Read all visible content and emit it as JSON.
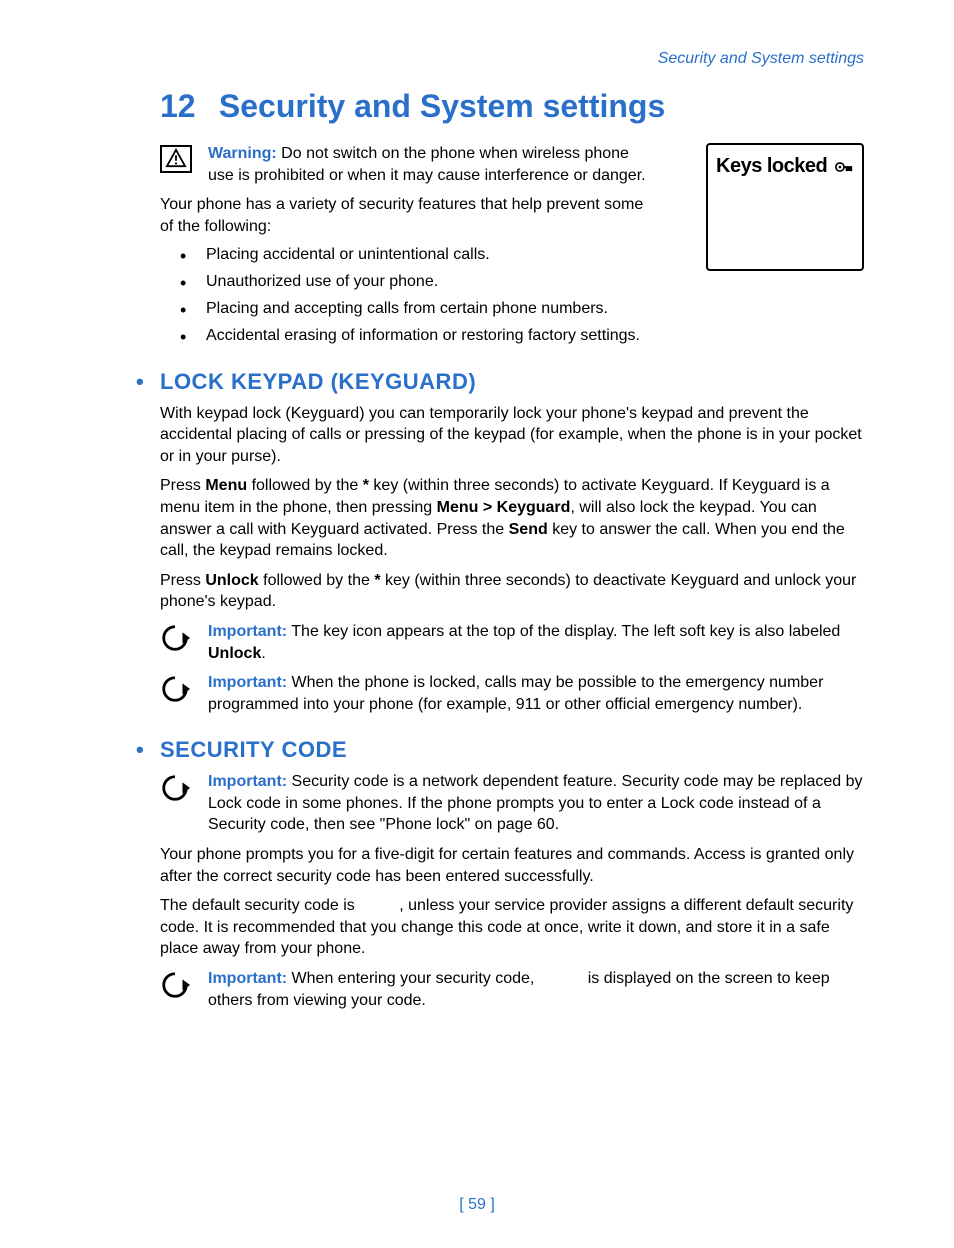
{
  "running_head": "Security and System settings",
  "chapter": {
    "number": "12",
    "title": "Security and System settings"
  },
  "warning": {
    "label": "Warning:",
    "text": " Do not switch on the phone when wireless phone use is prohibited or when it may cause interference or danger."
  },
  "screen_label": "Keys locked",
  "intro_para": "Your phone has a variety of security features that help prevent some of the following:",
  "bullets": [
    "Placing accidental or unintentional calls.",
    "Unauthorized use of your phone.",
    "Placing and accepting calls from certain phone numbers.",
    "Accidental erasing of information or restoring factory settings."
  ],
  "section1": {
    "heading": "LOCK KEYPAD (KEYGUARD)",
    "p1": "With keypad lock (Keyguard) you can temporarily lock your phone's keypad and prevent the accidental placing of calls or pressing of the keypad (for example, when the phone is in your pocket or in your purse).",
    "p2_parts": {
      "a": "Press ",
      "b_menu": "Menu",
      "c": " followed by the ",
      "d_star": "*",
      "e": " key (within three seconds) to activate Keyguard. If Keyguard is a menu item in the phone, then pressing ",
      "f_path": "Menu > Keyguard",
      "g": ", will also lock the keypad. You can answer a call with Keyguard activated. Press the ",
      "h_send": "Send",
      "i": " key to answer the call. When you end the call, the keypad remains locked."
    },
    "p3_parts": {
      "a": "Press ",
      "b_unlock": "Unlock",
      "c": " followed by the ",
      "d_star": "*",
      "e": " key (within three seconds) to deactivate Keyguard and unlock your phone's keypad."
    },
    "note1": {
      "label": "Important:",
      "t1": " The key icon appears at the top of the display. The left soft key is also labeled ",
      "b_unlock": "Unlock",
      "t2": "."
    },
    "note2": {
      "label": "Important:",
      "text": " When the phone is locked, calls may be possible to the emergency number programmed into your phone (for example, 911 or other official emergency number)."
    }
  },
  "section2": {
    "heading": "SECURITY CODE",
    "note1": {
      "label": "Important:",
      "text": " Security code is a network dependent feature. Security code may be replaced by Lock code in some phones. If the phone prompts you to enter a Lock code instead of a Security code, then see \"Phone lock\" on page 60."
    },
    "p1": "Your phone prompts you for a five-digit for certain features and commands. Access is granted only after the correct security code has been entered successfully.",
    "p2_parts": {
      "a": "The default security code is ",
      "blank1": "         ",
      "b": ", unless your service provider assigns a different default security code. It is recommended that you change this code at once, write it down, and store it in a safe place away from your phone."
    },
    "note2": {
      "label": "Important:",
      "t1": " When entering your security code, ",
      "blank": "          ",
      "t2": " is displayed on the screen to keep others from viewing your code."
    }
  },
  "page_number": "[ 59 ]"
}
